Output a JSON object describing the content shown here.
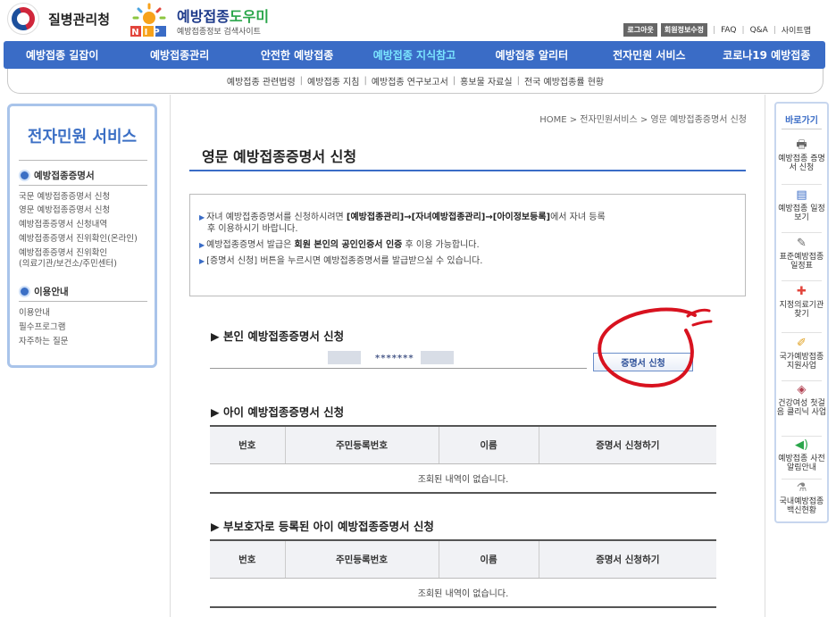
{
  "header": {
    "org_name": "질병관리청",
    "site_title_main": "예방접종",
    "site_title_accent": "도우미",
    "site_subtitle": "예방접종정보 검색사이트",
    "nip_letters": "NIP",
    "util": {
      "logout": "로그아웃",
      "edit_member": "회원정보수정",
      "faq": "FAQ",
      "qa": "Q&A",
      "sitemap": "사이트맵"
    }
  },
  "nav": {
    "items": [
      {
        "label": "예방접종 길잡이"
      },
      {
        "label": "예방접종관리"
      },
      {
        "label": "안전한 예방접종"
      },
      {
        "label": "예방접종 지식참고"
      },
      {
        "label": "예방접종 알리터"
      },
      {
        "label": "전자민원 서비스"
      },
      {
        "label": "코로나19 예방접종"
      }
    ],
    "sub_items": [
      {
        "label": "예방접종 관련법령"
      },
      {
        "label": "예방접종 지침"
      },
      {
        "label": "예방접종 연구보고서"
      },
      {
        "label": "홍보물 자료실"
      },
      {
        "label": "전국 예방접종률 현황"
      }
    ]
  },
  "sidebar": {
    "title": "전자민원 서비스",
    "section1": "예방접종증명서",
    "items1": [
      "국문 예방접종증명서 신청",
      "영문 예방접종증명서 신청",
      "예방접종증명서 신청내역",
      "예방접종증명서 진위확인(온라인)",
      "예방접종증명서 진위확인",
      "(의료기관/보건소/주민센터)"
    ],
    "section2": "이용안내",
    "items2": [
      "이용안내",
      "필수프로그램",
      "자주하는 질문"
    ]
  },
  "content": {
    "breadcrumb": "HOME > 전자민원서비스 > 영문 예방접종증명서 신청",
    "page_title": "영문 예방접종증명서 신청",
    "info": {
      "line1_pre": "자녀 예방접종증명서를 신청하시려면 ",
      "line1_bold": "[예방접종관리]→[자녀예방접종관리]→[아이정보등록]",
      "line1_post": "에서 자녀 등록",
      "line1_cont": "후 이용하시기 바랍니다.",
      "line2_pre": "예방접종증명서 발급은 ",
      "line2_bold": "회원 본인의 공인인증서 인증",
      "line2_post": " 후 이용 가능합니다.",
      "line3": "[증명서 신청] 버튼을 누르시면 예방접종증명서를 발급받으실 수 있습니다."
    },
    "self_section": {
      "title": "▶ 본인 예방접종증명서 신청",
      "masked": "*******",
      "button": "증명서 신청"
    },
    "child_section": {
      "title": "▶ 아이 예방접종증명서 신청",
      "columns": [
        "번호",
        "주민등록번호",
        "이름",
        "증명서 신청하기"
      ],
      "empty": "조회된 내역이 없습니다."
    },
    "guardian_section": {
      "title": "▶ 부보호자로 등록된 아이 예방접종증명서 신청",
      "columns": [
        "번호",
        "주민등록번호",
        "이름",
        "증명서 신청하기"
      ],
      "empty": "조회된 내역이 없습니다."
    }
  },
  "quickbar": {
    "title": "바로가기",
    "items": [
      {
        "icon": "printer-icon",
        "label": "예방접종 증명서 신청"
      },
      {
        "icon": "calendar-icon",
        "label": "예방접종 일정보기"
      },
      {
        "icon": "pen-icon",
        "label": "표준예방접종 일정표"
      },
      {
        "icon": "hospital-icon",
        "label": "지정의료기관 찾기"
      },
      {
        "icon": "document-icon",
        "label": "국가예방접종 지원사업"
      },
      {
        "icon": "box-icon",
        "label": "건강여성 첫걸음 클리닉 사업"
      },
      {
        "icon": "speaker-icon",
        "label": "예방접종 사전알림안내"
      },
      {
        "icon": "vaccine-icon",
        "label": "국내예방접종 백신현황"
      }
    ]
  }
}
